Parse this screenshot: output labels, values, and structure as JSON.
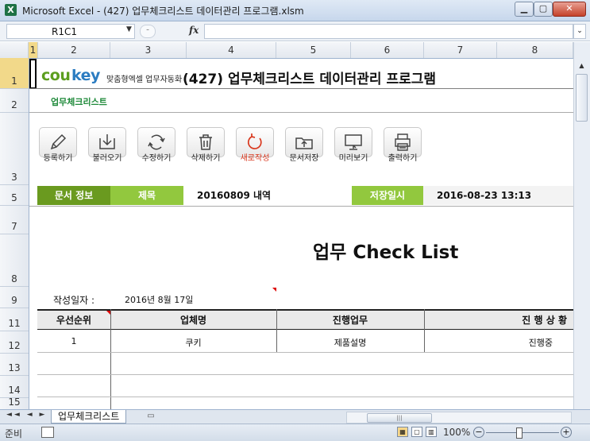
{
  "window": {
    "title": "Microsoft Excel - (427) 업무체크리스트 데이터관리 프로그램.xlsm",
    "app_icon": "X"
  },
  "formula_bar": {
    "name_box": "R1C1",
    "fx": "fx",
    "value": ""
  },
  "columns": [
    "1",
    "2",
    "3",
    "4",
    "5",
    "6",
    "7",
    "8"
  ],
  "rows": [
    "1",
    "2",
    "3",
    "5",
    "7",
    "8",
    "9",
    "11",
    "12",
    "13",
    "14",
    "15"
  ],
  "header": {
    "logo_a": "cou",
    "logo_b": "key",
    "logo_sub": "맞춤형엑셀 업무자동화",
    "title": "(427) 업무체크리스트 데이터관리 프로그램"
  },
  "subtitle": "업무체크리스트",
  "toolbar": [
    {
      "icon": "pencil-icon",
      "label": "등록하기"
    },
    {
      "icon": "load-icon",
      "label": "불러오기"
    },
    {
      "icon": "refresh-icon",
      "label": "수정하기"
    },
    {
      "icon": "trash-icon",
      "label": "삭제하기"
    },
    {
      "icon": "new-icon",
      "label": "새로작성"
    },
    {
      "icon": "save-folder-icon",
      "label": "문서저장"
    },
    {
      "icon": "preview-icon",
      "label": "미리보기"
    },
    {
      "icon": "printer-icon",
      "label": "출력하기"
    }
  ],
  "info": {
    "doc_info": "문서 정보",
    "title_label": "제목",
    "title_value": "20160809 내역",
    "saved_label": "저장일시",
    "saved_value": "2016-08-23 13:13"
  },
  "checklist_title": "업무 Check List",
  "created": {
    "label": "작성일자 :",
    "value": "2016년 8월 17일"
  },
  "table": {
    "headers": [
      "우선순위",
      "업체명",
      "진행업무",
      "진 행 상 황"
    ],
    "rows": [
      [
        "1",
        "쿠키",
        "제품설명",
        "진행중"
      ]
    ]
  },
  "sheet_tab": "업무체크리스트",
  "status": {
    "ready": "준비",
    "zoom": "100%"
  },
  "colors": {
    "accent_green": "#6a9a1f",
    "light_green": "#92c83e",
    "new_red": "#d9381e"
  }
}
